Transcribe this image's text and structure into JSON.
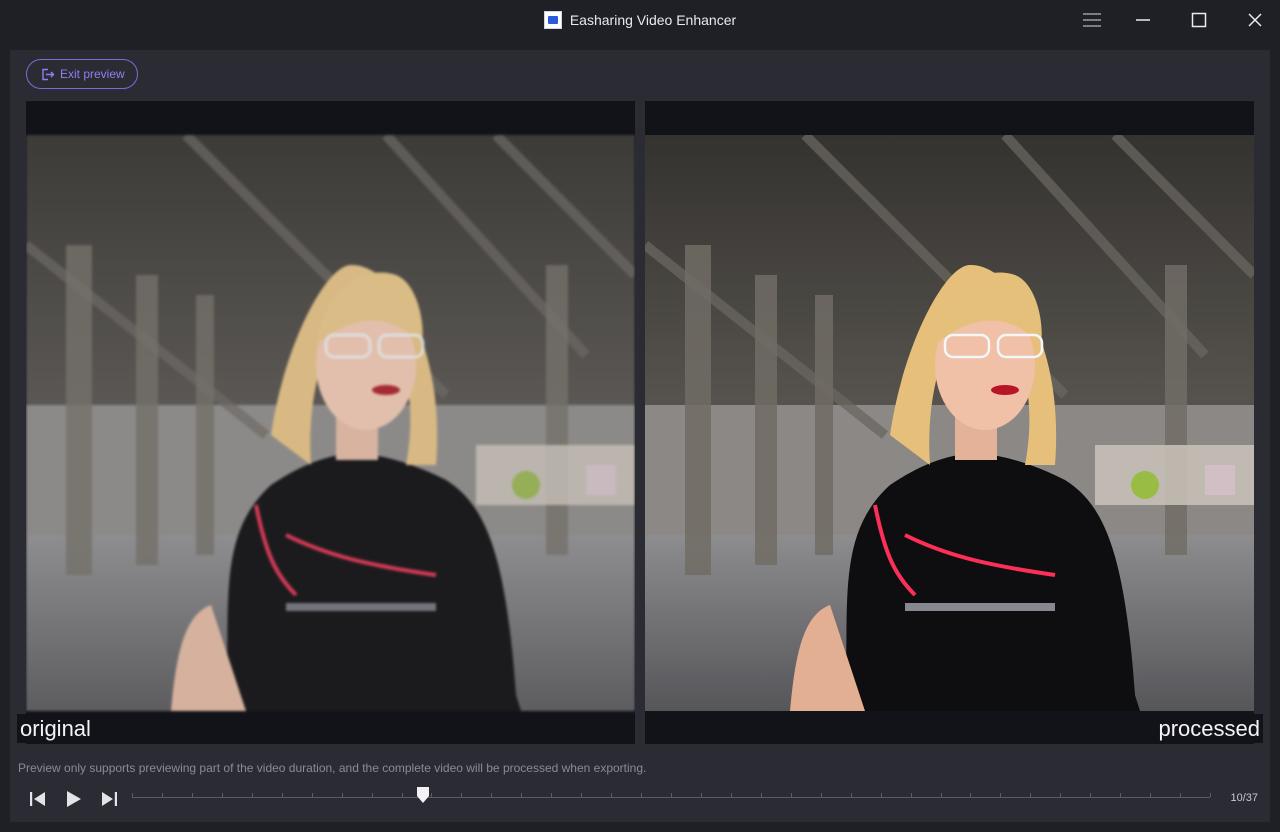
{
  "window": {
    "title": "Easharing Video Enhancer",
    "icons": [
      "app-logo-icon",
      "hamburger-menu-icon",
      "minimize-icon",
      "maximize-icon",
      "close-icon"
    ]
  },
  "toolbar": {
    "exit_label": "Exit preview",
    "exit_icon": "exit-icon",
    "accent_color": "#7c6ad8"
  },
  "preview": {
    "left_label": "original",
    "right_label": "processed",
    "notice": "Preview only supports previewing part of the video duration, and the complete video will be processed when exporting."
  },
  "playback": {
    "controls": [
      "previous-frame-icon",
      "play-icon",
      "next-frame-icon"
    ],
    "current_frame": 10,
    "total_frames": 37,
    "frame_counter": "10/37"
  }
}
